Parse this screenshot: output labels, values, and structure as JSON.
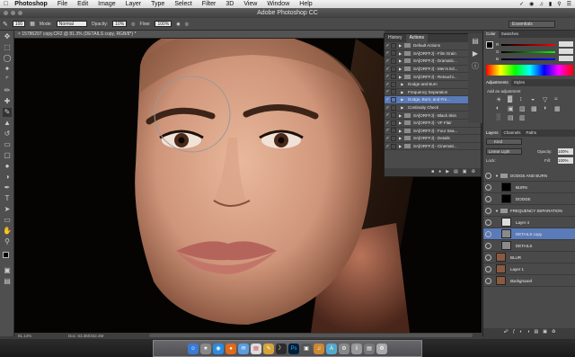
{
  "menubar": {
    "items": [
      "Photoshop",
      "File",
      "Edit",
      "Image",
      "Layer",
      "Type",
      "Select",
      "Filter",
      "3D",
      "View",
      "Window",
      "Help"
    ],
    "right_icons": [
      "bluetooth-icon",
      "wifi-icon",
      "volume-icon",
      "battery-icon",
      "search-icon",
      "list-icon"
    ]
  },
  "window": {
    "title": "Adobe Photoshop CC"
  },
  "options": {
    "brush_size": "100",
    "mode_label": "Mode:",
    "mode_value": "Normal",
    "opacity_label": "Opacity:",
    "opacity_value": "10%",
    "flow_label": "Flow:",
    "flow_value": "100%",
    "workspace": "Essentials"
  },
  "document": {
    "tab_title": "15786297 copy.CR2 @ 81.3% (DETAILS copy, RGB/8*) *",
    "zoom": "81.14%",
    "doc_info": "Doc: 63.3M/342.4M"
  },
  "actions_panel": {
    "tabs": [
      "History",
      "Actions"
    ],
    "active_tab": "Actions",
    "rows": [
      {
        "label": "Default Actions",
        "type": "set",
        "selected": false
      },
      {
        "label": "SA[ORFFJ] - Film Grain",
        "type": "set",
        "selected": false
      },
      {
        "label": "SA[ORFFJ] - Dramatic...",
        "type": "set",
        "selected": false
      },
      {
        "label": "SA[ORFFJ] - Men's Ed...",
        "type": "set",
        "selected": false
      },
      {
        "label": "SA[ORFFJ] - Retouchi...",
        "type": "set",
        "selected": false
      },
      {
        "label": "Dodge and Burn",
        "type": "action",
        "selected": false
      },
      {
        "label": "Frequency Separation",
        "type": "action",
        "selected": false
      },
      {
        "label": "Dodge, Burn, and Fre...",
        "type": "action",
        "selected": true
      },
      {
        "label": "Continuity Check",
        "type": "action",
        "selected": false
      },
      {
        "label": "SA[ORFFJ] - Black Skin",
        "type": "set",
        "selected": false
      },
      {
        "label": "SA[ORFFJ] - VF Flair",
        "type": "set",
        "selected": false
      },
      {
        "label": "SA[ORFFJ] - Four Sea...",
        "type": "set",
        "selected": false
      },
      {
        "label": "SA[ORFFJ] - Details",
        "type": "set",
        "selected": false
      },
      {
        "label": "SA[ORFFJ] - Cinemati...",
        "type": "set",
        "selected": false
      }
    ]
  },
  "color_panel": {
    "tabs": [
      "Color",
      "Swatches"
    ],
    "channels": [
      "R",
      "G",
      "B"
    ],
    "values": [
      "",
      "",
      ""
    ]
  },
  "adjustments_panel": {
    "tabs": [
      "Adjustments",
      "Styles"
    ],
    "heading": "Add an adjustment"
  },
  "layers_panel": {
    "tabs": [
      "Layers",
      "Channels",
      "Paths"
    ],
    "filter_label": "Kind",
    "blend_mode": "Linear Light",
    "opacity_label": "Opacity:",
    "opacity_value": "100%",
    "lock_label": "Lock:",
    "fill_label": "Fill:",
    "fill_value": "100%",
    "layers": [
      {
        "name": "DODGE AND BURN",
        "kind": "group",
        "selected": false
      },
      {
        "name": "BURN",
        "kind": "layer",
        "selected": false
      },
      {
        "name": "DODGE",
        "kind": "layer",
        "selected": false
      },
      {
        "name": "FREQUENCY SEPARATION",
        "kind": "group",
        "selected": false
      },
      {
        "name": "Layer 4",
        "kind": "layer",
        "selected": false
      },
      {
        "name": "DETAILS copy",
        "kind": "layer",
        "selected": true
      },
      {
        "name": "DETAILS",
        "kind": "layer",
        "selected": false
      },
      {
        "name": "BLUR",
        "kind": "layer",
        "selected": false
      },
      {
        "name": "Layer 1",
        "kind": "layer",
        "selected": false
      },
      {
        "name": "Background",
        "kind": "layer",
        "selected": false
      }
    ]
  },
  "colors": {
    "selection": "#5a7ab8",
    "panel": "#4a4a4a",
    "canvas_bg": "#050302"
  }
}
